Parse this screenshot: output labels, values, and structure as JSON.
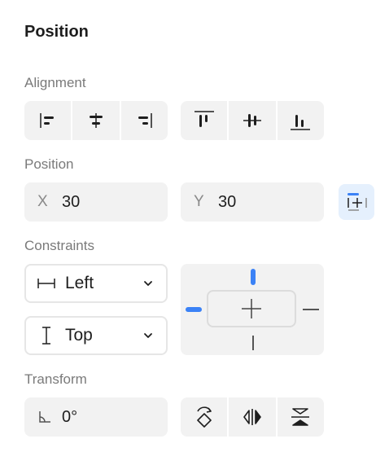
{
  "panel": {
    "title": "Position"
  },
  "alignment": {
    "label": "Alignment",
    "horizontal_icons": [
      "align-left-icon",
      "align-horizontal-center-icon",
      "align-right-icon"
    ],
    "vertical_icons": [
      "align-top-icon",
      "align-vertical-center-icon",
      "align-bottom-icon"
    ]
  },
  "position": {
    "label": "Position",
    "x_label": "X",
    "x_value": "30",
    "y_label": "Y",
    "y_value": "30",
    "toggle_icon": "constraint-toggle-icon"
  },
  "constraints": {
    "label": "Constraints",
    "horizontal_value": "Left",
    "vertical_value": "Top",
    "horizontal_icon": "horizontal-constraint-icon",
    "vertical_icon": "vertical-constraint-icon"
  },
  "transform": {
    "label": "Transform",
    "rotation_value": "0°",
    "rotation_icon": "angle-icon",
    "buttons": [
      "rotate-icon",
      "flip-horizontal-icon",
      "flip-vertical-icon"
    ]
  },
  "colors": {
    "accent": "#3b82f6",
    "field_bg": "#f2f2f2",
    "label": "#7a7a7a"
  }
}
